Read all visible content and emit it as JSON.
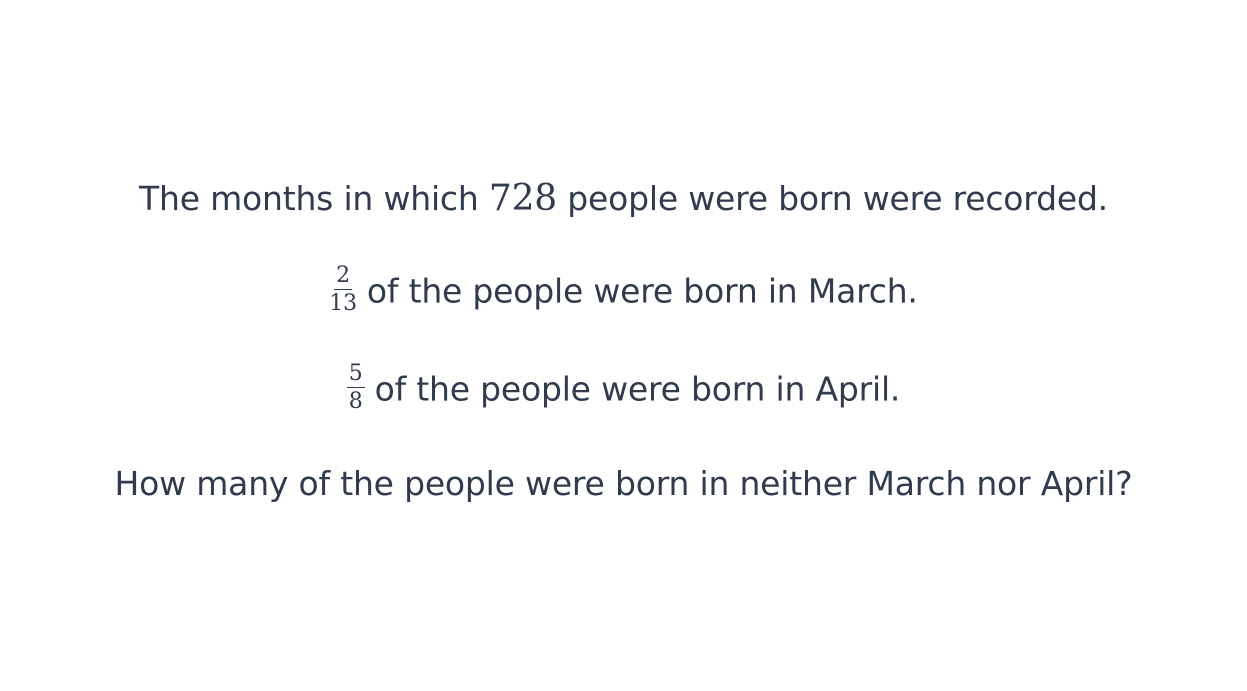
{
  "question": {
    "line1": {
      "before": "The months in which ",
      "number": "728",
      "after": " people were born were recorded."
    },
    "line2": {
      "fraction": {
        "numerator": "2",
        "denominator": "13"
      },
      "text": "of the people were born in March."
    },
    "line3": {
      "fraction": {
        "numerator": "5",
        "denominator": "8"
      },
      "text": "of the people were born in April."
    },
    "line4": {
      "text": "How many of the people were born in neither March nor April?"
    }
  },
  "colors": {
    "text": "#323a4d",
    "background": "#ffffff"
  }
}
